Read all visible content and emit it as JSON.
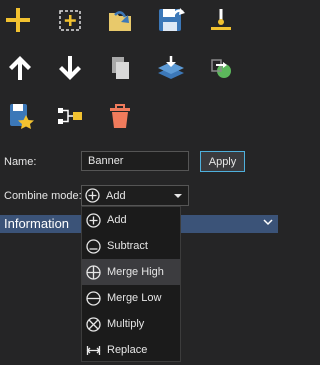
{
  "toolbar": {
    "icons": [
      "add-icon",
      "add-selection-icon",
      "import-folder-icon",
      "save-as-icon",
      "anchor-tool-icon",
      "move-up-icon",
      "move-down-icon",
      "duplicate-icon",
      "flatten-layers-icon",
      "export-to-layer-icon",
      "favorite-icon",
      "connect-icon",
      "delete-icon"
    ]
  },
  "name": {
    "label": "Name:",
    "value": "Banner"
  },
  "apply": {
    "label": "Apply"
  },
  "combine": {
    "label": "Combine mode:",
    "selected": "Add"
  },
  "info": {
    "title": "Information"
  },
  "dropdown": {
    "options": [
      "Add",
      "Subtract",
      "Merge High",
      "Merge Low",
      "Multiply",
      "Replace"
    ],
    "highlighted": "Merge High"
  },
  "colors": {
    "accent": "#f2c230",
    "selection_bar": "#3b5378",
    "hover": "#3c3c3f",
    "apply_border": "#4fb0dc"
  }
}
